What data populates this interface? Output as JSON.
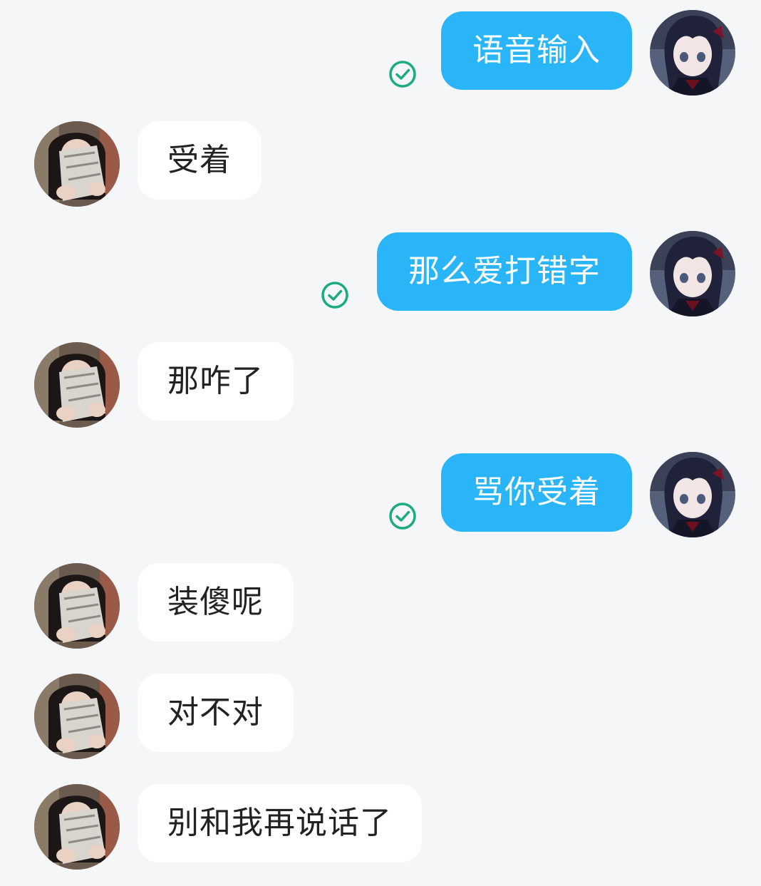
{
  "colors": {
    "background": "#f5f6f8",
    "sent_bubble": "#2ab5f8",
    "received_bubble": "#ffffff",
    "read_check": "#1aab7e"
  },
  "icons": {
    "read_receipt": "check-circle-icon",
    "sent_avatar": "anime-girl-avatar",
    "received_avatar": "photo-avatar"
  },
  "messages": [
    {
      "direction": "sent",
      "text": "语音输入",
      "read": true
    },
    {
      "direction": "received",
      "text": "受着"
    },
    {
      "direction": "sent",
      "text": "那么爱打错字",
      "read": true
    },
    {
      "direction": "received",
      "text": "那咋了"
    },
    {
      "direction": "sent",
      "text": "骂你受着",
      "read": true
    },
    {
      "direction": "received",
      "text": "装傻呢"
    },
    {
      "direction": "received",
      "text": "对不对"
    },
    {
      "direction": "received",
      "text": "别和我再说话了"
    }
  ]
}
